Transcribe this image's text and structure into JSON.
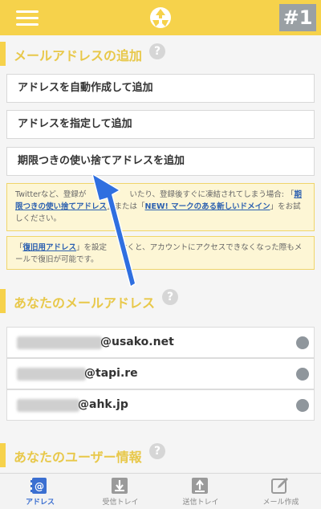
{
  "header": {
    "tag": "#1",
    "colors": {
      "header_bg": "#f6d24b",
      "accent_blue": "#3b6fd1",
      "notice_bg": "#fdf6d5"
    }
  },
  "add_section": {
    "title": "メールアドレスの追加",
    "help": "?",
    "buttons": [
      "アドレスを自動作成して追加",
      "アドレスを指定して追加",
      "期限つきの使い捨てアドレスを追加"
    ]
  },
  "notices": {
    "notice1": {
      "text_a": "Twitterなど、登録が",
      "text_b": "いたり、登録後すぐに凍結されてしまう場合: 「",
      "link_a": "期限つきの使い捨てアドレス",
      "text_c": "」または「",
      "link_b": "NEW! マークのある新しいドメイン",
      "text_d": "」をお試しください。"
    },
    "notice2": {
      "text_a": "「",
      "link_a": "復旧用アドレス",
      "text_b": "」を設定",
      "text_c": "おくと、アカウントにアクセスできなくなった際もメールで復旧が可能です。"
    }
  },
  "address_section": {
    "title": "あなたのメールアドレス",
    "help": "?",
    "addresses": [
      {
        "domain": "@usako.net"
      },
      {
        "domain": "@tapi.re"
      },
      {
        "domain": "@ahk.jp"
      }
    ]
  },
  "user_section": {
    "title": "あなたのユーザー情報",
    "help": "?"
  },
  "tabbar": {
    "tabs": [
      {
        "label": "アドレス",
        "icon": "address-book-icon",
        "active": true
      },
      {
        "label": "受信トレイ",
        "icon": "inbox-download-icon",
        "active": false
      },
      {
        "label": "送信トレイ",
        "icon": "outbox-upload-icon",
        "active": false
      },
      {
        "label": "メール作成",
        "icon": "compose-pencil-icon",
        "active": false
      }
    ]
  }
}
